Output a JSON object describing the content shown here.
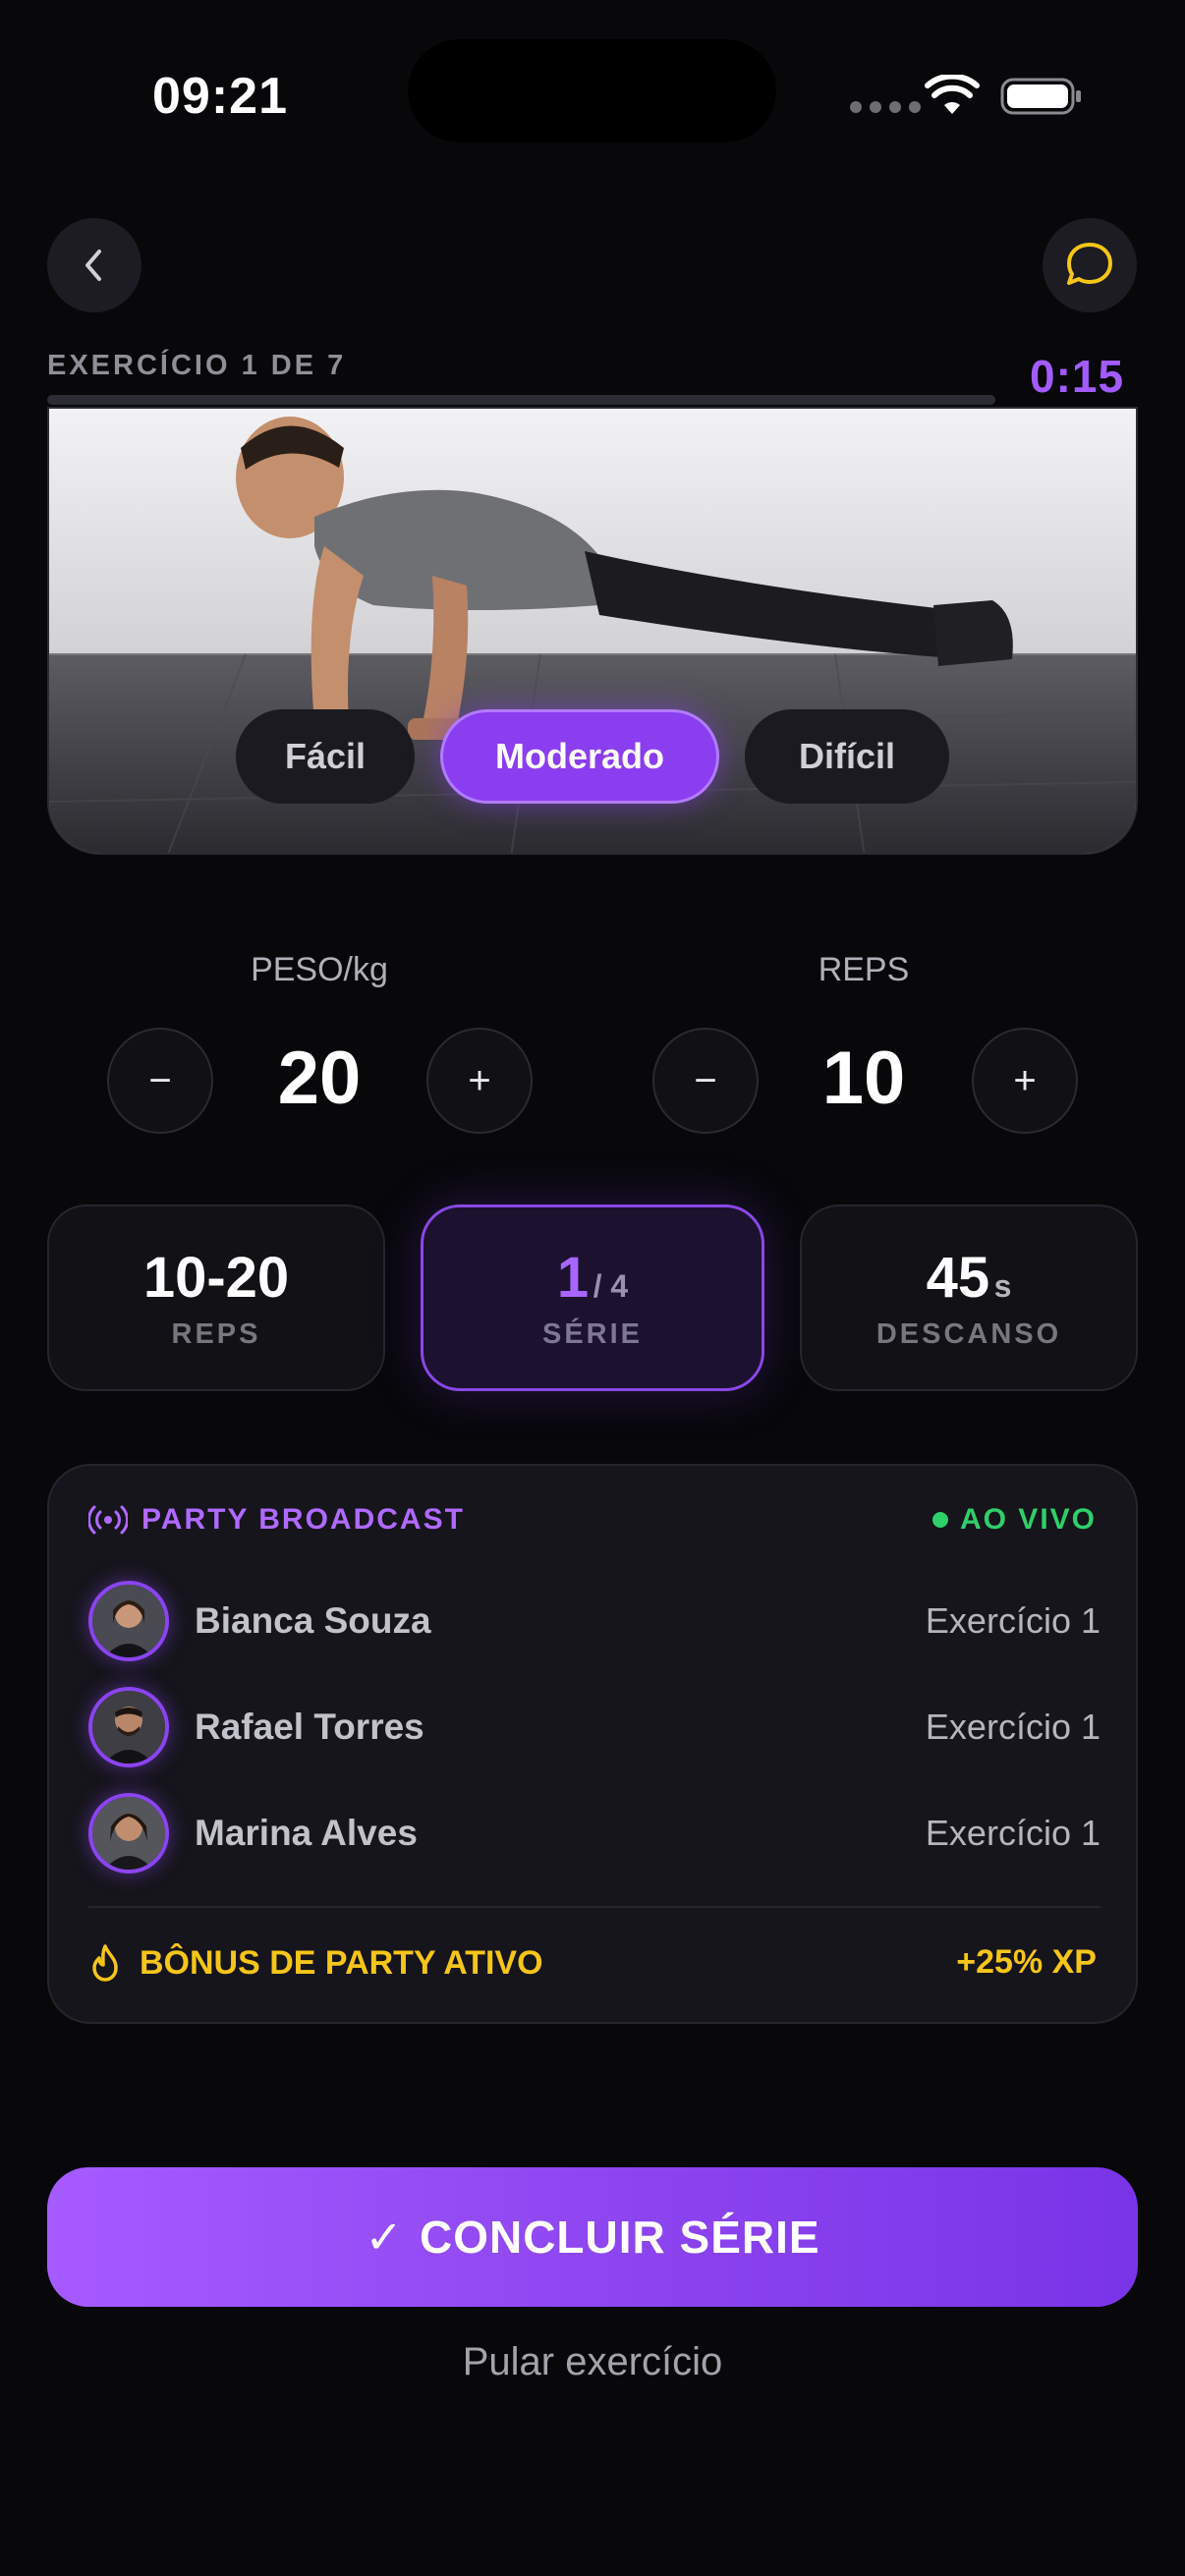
{
  "status_bar": {
    "time": "09:21"
  },
  "header": {
    "exercise_label": "EXERCÍCIO 1 DE 7",
    "timer": "0:15",
    "progress": 0.03
  },
  "difficulty": {
    "options": [
      "Fácil",
      "Moderado",
      "Difícil"
    ],
    "selected": "Moderado"
  },
  "steppers": {
    "weight": {
      "label": "PESO/kg",
      "value": "20",
      "minus": "−",
      "plus": "+"
    },
    "reps": {
      "label": "REPS",
      "value": "10",
      "minus": "−",
      "plus": "+"
    }
  },
  "stats": {
    "reps": {
      "value": "10-20",
      "caption": "REPS"
    },
    "series": {
      "current": "1",
      "total": "/ 4",
      "caption": "SÉRIE"
    },
    "rest": {
      "value": "45",
      "unit": "s",
      "caption": "DESCANSO"
    }
  },
  "party": {
    "title": "PARTY BROADCAST",
    "live_label": "AO VIVO",
    "members": [
      {
        "name": "Bianca Souza",
        "status": "Exercício 1"
      },
      {
        "name": "Rafael Torres",
        "status": "Exercício 1"
      },
      {
        "name": "Marina Alves",
        "status": "Exercício 1"
      }
    ],
    "bonus_label": "BÔNUS DE PARTY ATIVO",
    "bonus_value": "+25% XP"
  },
  "actions": {
    "complete_label": "CONCLUIR SÉRIE",
    "complete_check": "✓",
    "skip_label": "Pular exercício"
  },
  "colors": {
    "accent": "#8b3df0",
    "timer": "#a35bff",
    "live": "#2fcf6a",
    "bonus": "#f5c518",
    "background": "#08080b"
  },
  "icons": {
    "back": "chevron-left-icon",
    "chat": "chat-bubble-icon",
    "broadcast": "broadcast-icon",
    "fire": "flame-icon"
  }
}
